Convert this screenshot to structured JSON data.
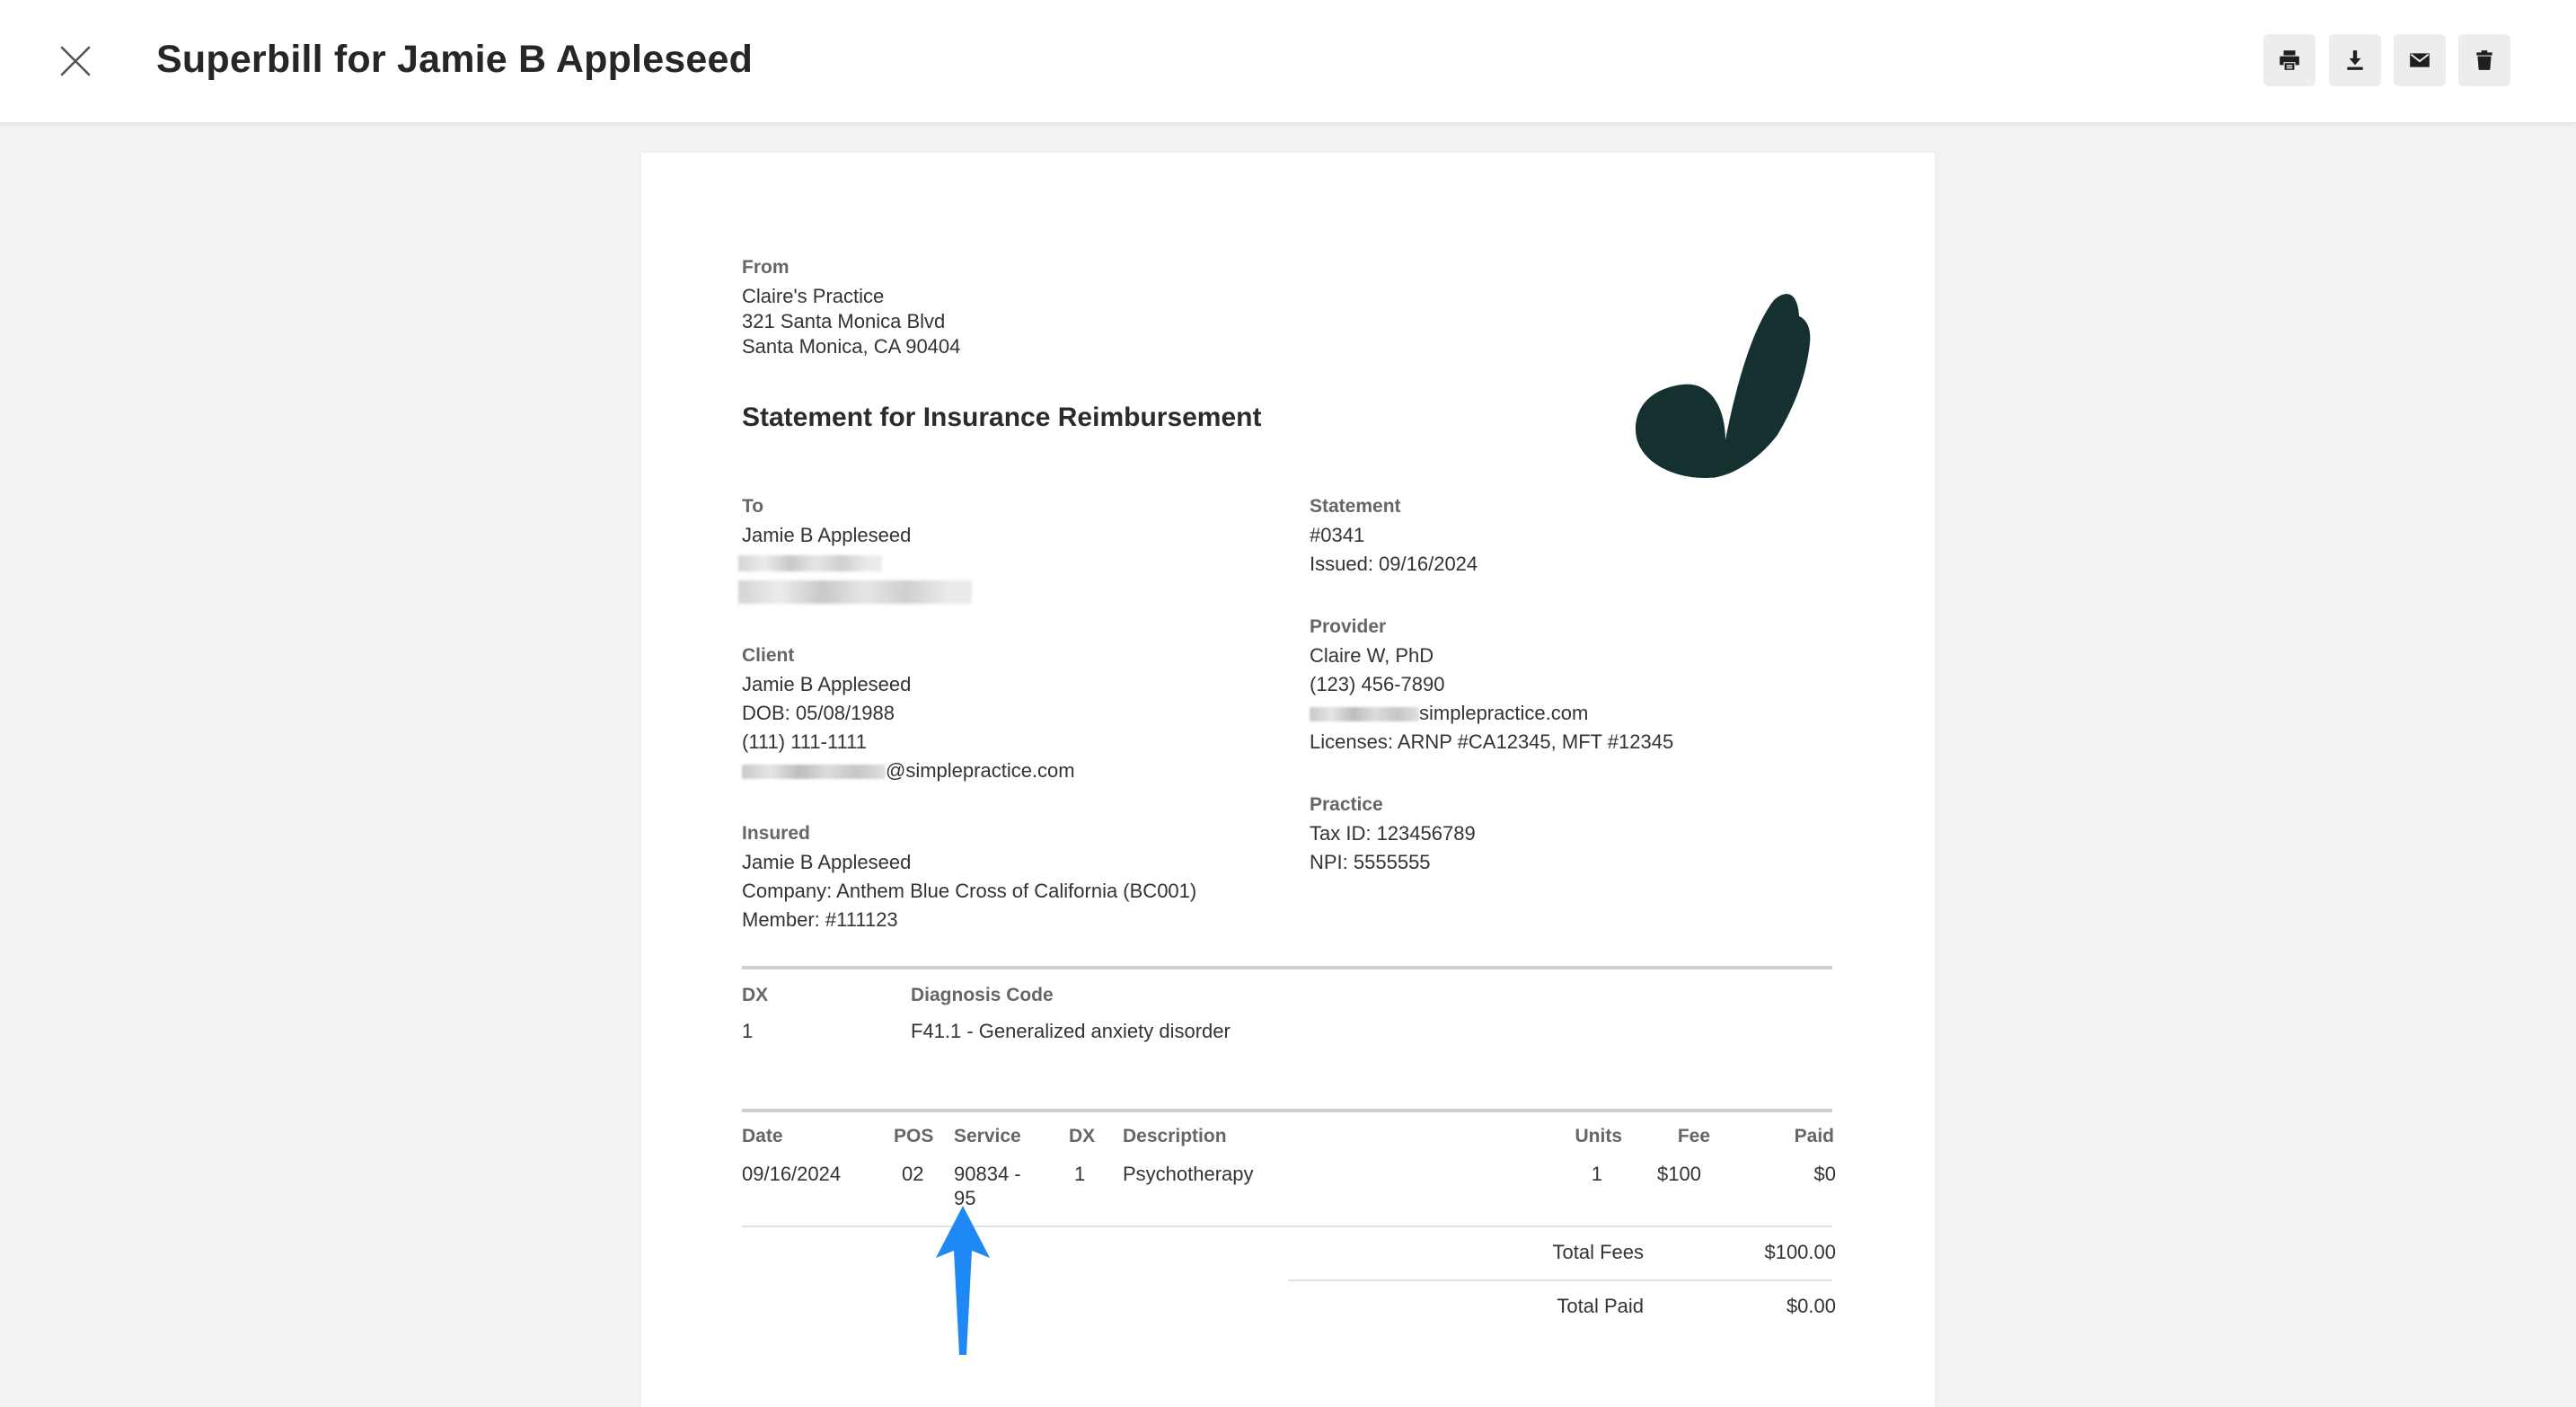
{
  "header": {
    "title": "Superbill for Jamie B Appleseed",
    "actions": [
      {
        "name": "print-button",
        "icon": "print-icon"
      },
      {
        "name": "download-button",
        "icon": "download-icon"
      },
      {
        "name": "email-button",
        "icon": "mail-icon"
      },
      {
        "name": "delete-button",
        "icon": "trash-icon"
      }
    ]
  },
  "doc": {
    "from": {
      "label": "From",
      "lines": [
        "Claire's Practice",
        "321 Santa Monica Blvd",
        "Santa Monica, CA 90404"
      ]
    },
    "title": "Statement for Insurance Reimbursement",
    "to": {
      "label": "To",
      "name": "Jamie B Appleseed"
    },
    "client": {
      "label": "Client",
      "name": "Jamie B Appleseed",
      "dob": "DOB: 05/08/1988",
      "phone": "(111) 111-1111",
      "email_suffix": "@simplepractice.com"
    },
    "insured": {
      "label": "Insured",
      "name": "Jamie B Appleseed",
      "company": "Company: Anthem Blue Cross of California (BC001)",
      "member": "Member: #111123"
    },
    "statement": {
      "label": "Statement",
      "number": "#0341",
      "issued": "Issued: 09/16/2024"
    },
    "provider": {
      "label": "Provider",
      "name": "Claire W, PhD",
      "phone": "(123) 456-7890",
      "email_suffix": "simplepractice.com",
      "licenses": "Licenses: ARNP #CA12345, MFT #12345"
    },
    "practice": {
      "label": "Practice",
      "tax_id": "Tax ID: 123456789",
      "npi": "NPI: 5555555"
    },
    "diagnosis": {
      "headers": {
        "dx": "DX",
        "code": "Diagnosis Code"
      },
      "rows": [
        {
          "dx": "1",
          "code": "F41.1 - Generalized anxiety disorder"
        }
      ]
    },
    "services": {
      "headers": {
        "date": "Date",
        "pos": "POS",
        "service": "Service",
        "dx": "DX",
        "description": "Description",
        "units": "Units",
        "fee": "Fee",
        "paid": "Paid"
      },
      "rows": [
        {
          "date": "09/16/2024",
          "pos": "02",
          "service_line1": "90834 -",
          "service_line2": "95",
          "dx": "1",
          "description": "Psychotherapy",
          "units": "1",
          "fee": "$100",
          "paid": "$0"
        }
      ]
    },
    "totals": {
      "fees_label": "Total Fees",
      "fees_value": "$100.00",
      "paid_label": "Total Paid",
      "paid_value": "$0.00"
    }
  },
  "colors": {
    "logo": "#14312f",
    "arrow": "#1e88f5"
  }
}
